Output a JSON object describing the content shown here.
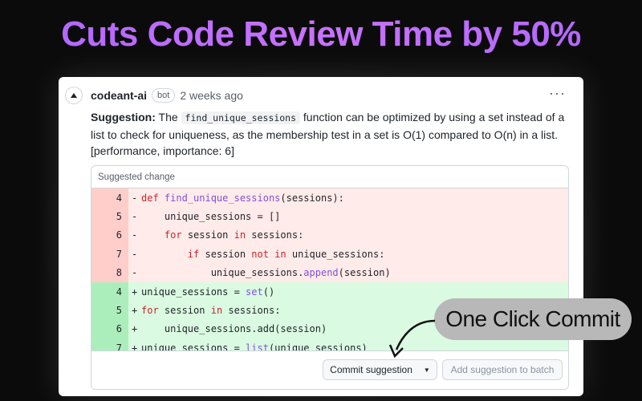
{
  "headline": "Cuts Code Review Time by 50%",
  "comment": {
    "author": "codeant-ai",
    "badge": "bot",
    "timestamp": "2 weeks ago",
    "more_icon": "…",
    "suggestion_label": "Suggestion:",
    "text_before_code": "The",
    "inline_code": "find_unique_sessions",
    "text_after_code": "function can be optimized by using a set instead of a list to check for uniqueness, as the membership test in a set is O(1) compared to O(n) in a list. [performance, importance: 6]"
  },
  "suggested_change": {
    "title": "Suggested change",
    "removed_lines": [
      {
        "ln": "4",
        "sign": "-",
        "indent": "",
        "tokens": [
          {
            "t": "def ",
            "c": "kw"
          },
          {
            "t": "find_unique_sessions",
            "c": "fn"
          },
          {
            "t": "(sessions):",
            "c": ""
          }
        ]
      },
      {
        "ln": "5",
        "sign": "-",
        "indent": "    ",
        "tokens": [
          {
            "t": "unique_sessions = []",
            "c": ""
          }
        ]
      },
      {
        "ln": "6",
        "sign": "-",
        "indent": "    ",
        "tokens": [
          {
            "t": "for",
            "c": "kw"
          },
          {
            "t": " session ",
            "c": ""
          },
          {
            "t": "in",
            "c": "kw"
          },
          {
            "t": " sessions:",
            "c": ""
          }
        ]
      },
      {
        "ln": "7",
        "sign": "-",
        "indent": "        ",
        "tokens": [
          {
            "t": "if",
            "c": "kw"
          },
          {
            "t": " session ",
            "c": ""
          },
          {
            "t": "not in",
            "c": "kw"
          },
          {
            "t": " unique_sessions:",
            "c": ""
          }
        ]
      },
      {
        "ln": "8",
        "sign": "-",
        "indent": "            ",
        "tokens": [
          {
            "t": "unique_sessions.",
            "c": ""
          },
          {
            "t": "append",
            "c": "fn"
          },
          {
            "t": "(session)",
            "c": ""
          }
        ]
      }
    ],
    "added_lines": [
      {
        "ln": "4",
        "sign": "+",
        "indent": "",
        "tokens": [
          {
            "t": "unique_sessions = ",
            "c": ""
          },
          {
            "t": "set",
            "c": "fn"
          },
          {
            "t": "()",
            "c": ""
          }
        ]
      },
      {
        "ln": "5",
        "sign": "+",
        "indent": "",
        "tokens": [
          {
            "t": "for",
            "c": "kw"
          },
          {
            "t": " session ",
            "c": ""
          },
          {
            "t": "in",
            "c": "kw"
          },
          {
            "t": " sessions:",
            "c": ""
          }
        ]
      },
      {
        "ln": "6",
        "sign": "+",
        "indent": "    ",
        "tokens": [
          {
            "t": "unique_sessions.add(session)",
            "c": ""
          }
        ]
      },
      {
        "ln": "7",
        "sign": "+",
        "indent": "",
        "tokens": [
          {
            "t": "unique_sessions = ",
            "c": ""
          },
          {
            "t": "list",
            "c": "fn"
          },
          {
            "t": "(unique_sessions)",
            "c": ""
          }
        ]
      }
    ],
    "commit_button": "Commit suggestion",
    "batch_button": "Add suggestion to batch"
  },
  "callout": "One Click Commit",
  "colors": {
    "headline": "#b066ff",
    "removed_bg": "#ffebe9",
    "added_bg": "#dafbe1",
    "keyword": "#cf222e",
    "function": "#8250df"
  }
}
